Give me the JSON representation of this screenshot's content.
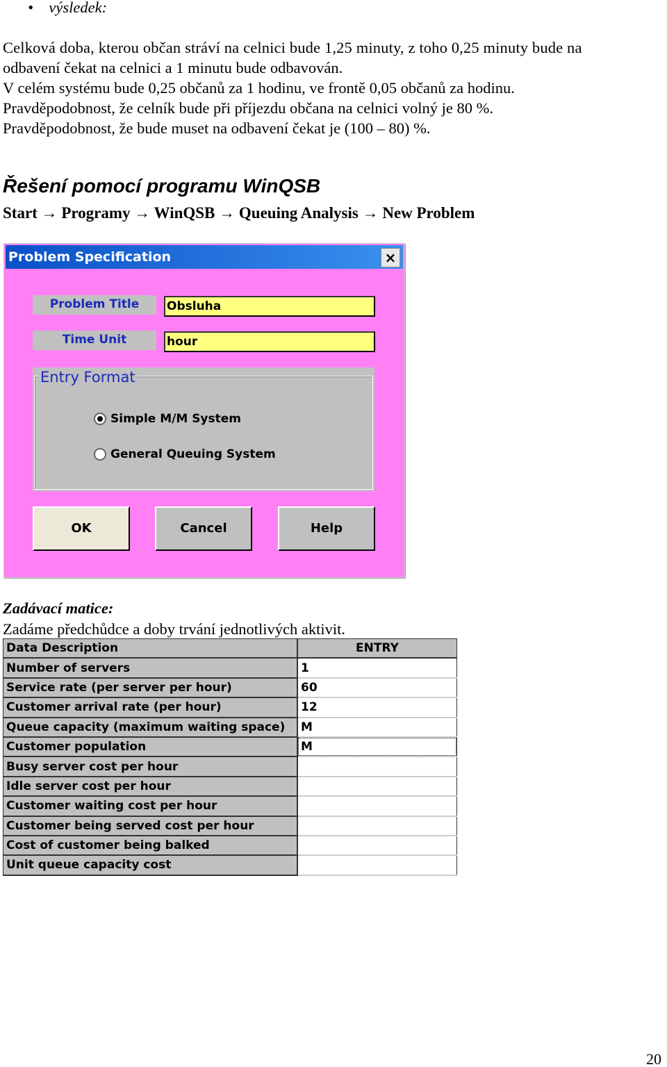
{
  "bullet_label": "výsledek:",
  "paragraphs": [
    "Celková doba, kterou občan stráví na celnici bude 1,25 minuty, z toho 0,25 minuty bude na",
    "odbavení čekat na celnici a 1 minutu bude odbavován.",
    "V celém systému bude 0,25 občanů za 1 hodinu, ve frontě 0,05 občanů za hodinu.",
    "Pravděpodobnost, že celník bude při příjezdu občana na celnici volný je 80 %.",
    "Pravděpodobnost, že bude muset na odbavení čekat je (100 – 80) %."
  ],
  "heading": "Řešení pomocí programu WinQSB",
  "menu_path": "Start → Programy → WinQSB → Queuing Analysis  → New Problem",
  "dialog": {
    "title": "Problem Specification",
    "close": "×",
    "problem_title_label": "Problem Title",
    "problem_title_value": "Obsluha",
    "time_unit_label": "Time Unit",
    "time_unit_value": "hour",
    "entry_format_label": "Entry Format",
    "options": [
      {
        "label": "Simple M/M System",
        "selected": true
      },
      {
        "label": "General Queuing System",
        "selected": false
      }
    ],
    "buttons": {
      "ok": "OK",
      "cancel": "Cancel",
      "help": "Help"
    },
    "colors": {
      "background": "#ff80f4",
      "input": "#ffff80",
      "label_text": "#1a2ab8"
    }
  },
  "matrix_heading": "Zadávací matice:",
  "matrix_text": "Zadáme předchůdce a doby trvání jednotlivých aktivit.",
  "table": {
    "headers": [
      "Data Description",
      "ENTRY"
    ],
    "rows": [
      [
        "Number of servers",
        "1"
      ],
      [
        "Service rate (per server per hour)",
        "60"
      ],
      [
        "Customer arrival rate (per hour)",
        "12"
      ],
      [
        "Queue capacity (maximum waiting space)",
        "M"
      ],
      [
        "Customer population",
        "M"
      ],
      [
        "Busy server cost per hour",
        ""
      ],
      [
        "Idle server cost per hour",
        ""
      ],
      [
        "Customer waiting cost per hour",
        ""
      ],
      [
        "Customer being served cost per hour",
        ""
      ],
      [
        "Cost of customer being balked",
        ""
      ],
      [
        "Unit queue capacity cost",
        ""
      ]
    ]
  },
  "page_number": "20"
}
